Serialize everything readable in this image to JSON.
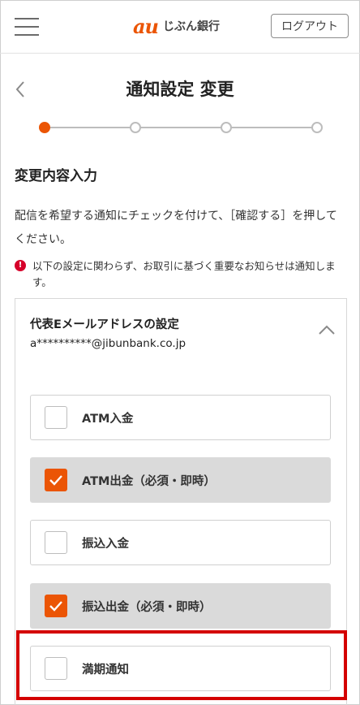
{
  "header": {
    "logo_mark": "au",
    "logo_text": "じぶん銀行",
    "logout_label": "ログアウト"
  },
  "page": {
    "title": "通知設定 変更",
    "stepper": {
      "total_steps": 4,
      "current_step": 1
    },
    "section_heading": "変更内容入力",
    "instruction": "配信を希望する通知にチェックを付けて、［確認する］を押してください。",
    "notice": {
      "icon": "!",
      "text": "以下の設定に関わらず、お取引に基づく重要なお知らせは通知します。"
    }
  },
  "card": {
    "label": "代表Eメールアドレスの設定",
    "email": "a**********@jibunbank.co.jp",
    "options": [
      {
        "label": "ATM入金",
        "checked": false
      },
      {
        "label": "ATM出金（必須・即時）",
        "checked": true
      },
      {
        "label": "振込入金",
        "checked": false
      },
      {
        "label": "振込出金（必須・即時）",
        "checked": true
      },
      {
        "label": "満期通知",
        "checked": false
      }
    ]
  },
  "colors": {
    "accent": "#eb5505",
    "checked_bg": "#dadada",
    "highlight": "#d40000",
    "notice_icon": "#d6002a"
  }
}
